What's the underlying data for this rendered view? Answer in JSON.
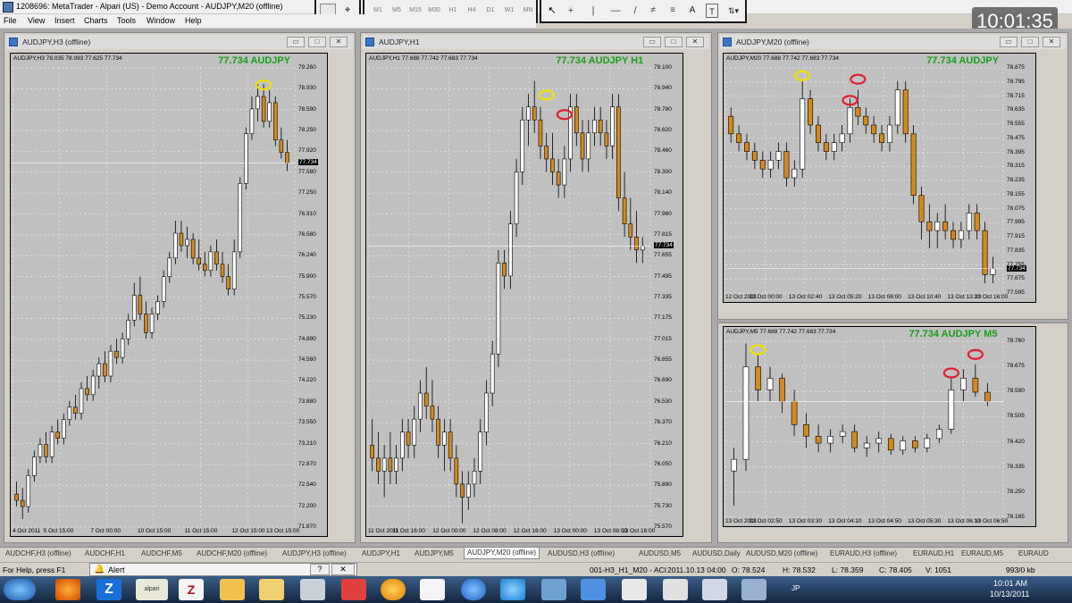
{
  "window_title": "1208696: MetaTrader - Alpari (US) - Demo Account - AUDJPY,M20 (offline)",
  "menu": [
    "File",
    "View",
    "Insert",
    "Charts",
    "Tools",
    "Window",
    "Help"
  ],
  "timeframes": [
    "M1",
    "M5",
    "M15",
    "M30",
    "H1",
    "H4",
    "D1",
    "W1",
    "MN"
  ],
  "clock": "10:01:35",
  "charts": [
    {
      "title": "AUDJPY,H3 (offline)",
      "info": "AUDJPY,H3  78.035 78.093 77.625 77.734",
      "big_label": "77.734 AUDJPY",
      "current": "77.734",
      "price_labels": [
        "79.260",
        "78.930",
        "78.590",
        "78.250",
        "77.920",
        "77.580",
        "77.250",
        "76.910",
        "76.580",
        "76.240",
        "75.900",
        "75.570",
        "75.230",
        "74.890",
        "74.560",
        "74.220",
        "73.880",
        "73.550",
        "73.210",
        "72.870",
        "72.540",
        "72.200",
        "71.870"
      ],
      "time_labels": [
        "4 Oct 2011",
        "5 Oct 15:00",
        "7 Oct 00:00",
        "10 Oct 15:00",
        "11 Oct 15:00",
        "12 Oct 15:00",
        "13 Oct 15:00"
      ],
      "ymin": 71.87,
      "ymax": 79.26,
      "candles": [
        [
          72.4,
          72.6,
          72.2,
          72.3
        ],
        [
          72.3,
          72.5,
          72.0,
          72.2
        ],
        [
          72.2,
          72.8,
          72.1,
          72.7
        ],
        [
          72.7,
          73.1,
          72.6,
          73.0
        ],
        [
          73.0,
          73.3,
          72.9,
          73.2
        ],
        [
          73.2,
          73.4,
          72.9,
          73.0
        ],
        [
          73.0,
          73.5,
          72.9,
          73.4
        ],
        [
          73.4,
          73.6,
          73.2,
          73.3
        ],
        [
          73.3,
          73.7,
          73.2,
          73.6
        ],
        [
          73.6,
          73.9,
          73.5,
          73.8
        ],
        [
          73.8,
          74.0,
          73.6,
          73.7
        ],
        [
          73.7,
          74.2,
          73.6,
          74.1
        ],
        [
          74.1,
          74.3,
          73.9,
          74.0
        ],
        [
          74.0,
          74.4,
          73.9,
          74.3
        ],
        [
          74.3,
          74.6,
          74.1,
          74.5
        ],
        [
          74.5,
          74.7,
          74.2,
          74.3
        ],
        [
          74.3,
          74.8,
          74.2,
          74.7
        ],
        [
          74.7,
          74.9,
          74.5,
          74.6
        ],
        [
          74.6,
          75.0,
          74.5,
          74.9
        ],
        [
          74.9,
          75.3,
          74.8,
          75.2
        ],
        [
          75.2,
          75.8,
          75.1,
          75.6
        ],
        [
          75.6,
          75.9,
          75.2,
          75.3
        ],
        [
          75.3,
          75.5,
          74.9,
          75.0
        ],
        [
          75.0,
          75.4,
          74.9,
          75.3
        ],
        [
          75.3,
          75.6,
          75.2,
          75.5
        ],
        [
          75.5,
          76.0,
          75.4,
          75.9
        ],
        [
          75.9,
          76.3,
          75.8,
          76.2
        ],
        [
          76.2,
          76.8,
          76.1,
          76.6
        ],
        [
          76.6,
          76.8,
          76.3,
          76.4
        ],
        [
          76.4,
          76.7,
          76.2,
          76.5
        ],
        [
          76.5,
          76.6,
          76.1,
          76.2
        ],
        [
          76.2,
          76.5,
          76.0,
          76.1
        ],
        [
          76.1,
          76.3,
          75.9,
          76.0
        ],
        [
          76.0,
          76.4,
          75.9,
          76.3
        ],
        [
          76.3,
          76.5,
          76.0,
          76.1
        ],
        [
          76.1,
          76.3,
          75.8,
          75.9
        ],
        [
          75.9,
          76.1,
          75.6,
          75.7
        ],
        [
          75.7,
          76.5,
          75.6,
          76.3
        ],
        [
          76.3,
          77.5,
          76.2,
          77.4
        ],
        [
          77.4,
          78.3,
          77.3,
          78.2
        ],
        [
          78.2,
          78.8,
          78.1,
          78.6
        ],
        [
          78.6,
          79.0,
          78.4,
          78.8
        ],
        [
          78.8,
          79.0,
          78.3,
          78.4
        ],
        [
          78.4,
          78.9,
          78.3,
          78.7
        ],
        [
          78.7,
          78.8,
          78.0,
          78.1
        ],
        [
          78.1,
          78.3,
          77.8,
          77.9
        ],
        [
          77.9,
          78.1,
          77.6,
          77.73
        ]
      ],
      "markers": [
        {
          "color": "yellow",
          "i": 42,
          "p": 78.9
        }
      ]
    },
    {
      "title": "AUDJPY,H1",
      "info": "AUDJPY,H1  77.688 77.742 77.683 77.734",
      "big_label": "77.734 AUDJPY H1",
      "current": "77.734",
      "price_labels": [
        "79.100",
        "78.940",
        "78.780",
        "78.620",
        "78.460",
        "78.300",
        "78.140",
        "77.980",
        "77.815",
        "77.655",
        "77.495",
        "77.335",
        "77.175",
        "77.015",
        "76.855",
        "76.690",
        "76.530",
        "76.370",
        "76.210",
        "76.050",
        "75.890",
        "75.730",
        "75.570"
      ],
      "time_labels": [
        "11 Oct 2011",
        "11 Oct 16:00",
        "12 Oct 00:00",
        "12 Oct 08:00",
        "12 Oct 16:00",
        "13 Oct 00:00",
        "13 Oct 08:00",
        "13 Oct 16:00"
      ],
      "ymin": 75.57,
      "ymax": 79.1,
      "candles": [
        [
          76.2,
          76.4,
          76.0,
          76.1
        ],
        [
          76.1,
          76.3,
          75.9,
          76.0
        ],
        [
          76.0,
          76.2,
          75.8,
          76.1
        ],
        [
          76.1,
          76.3,
          75.9,
          76.0
        ],
        [
          76.0,
          76.2,
          75.9,
          76.1
        ],
        [
          76.1,
          76.4,
          76.0,
          76.3
        ],
        [
          76.3,
          76.4,
          76.1,
          76.2
        ],
        [
          76.2,
          76.5,
          76.1,
          76.4
        ],
        [
          76.4,
          76.7,
          76.3,
          76.6
        ],
        [
          76.6,
          76.8,
          76.4,
          76.5
        ],
        [
          76.5,
          76.7,
          76.3,
          76.4
        ],
        [
          76.4,
          76.5,
          76.1,
          76.2
        ],
        [
          76.2,
          76.4,
          76.0,
          76.3
        ],
        [
          76.3,
          76.4,
          76.0,
          76.1
        ],
        [
          76.1,
          76.2,
          75.8,
          75.9
        ],
        [
          75.9,
          76.0,
          75.6,
          75.8
        ],
        [
          75.8,
          76.0,
          75.7,
          75.9
        ],
        [
          75.9,
          76.1,
          75.8,
          76.0
        ],
        [
          76.0,
          76.4,
          75.9,
          76.3
        ],
        [
          76.3,
          76.7,
          76.2,
          76.6
        ],
        [
          76.6,
          77.0,
          76.5,
          76.9
        ],
        [
          76.9,
          77.7,
          76.8,
          77.6
        ],
        [
          77.6,
          77.7,
          77.4,
          77.5
        ],
        [
          77.5,
          78.0,
          77.4,
          77.9
        ],
        [
          77.9,
          78.4,
          77.8,
          78.3
        ],
        [
          78.3,
          78.8,
          78.2,
          78.7
        ],
        [
          78.7,
          78.9,
          78.5,
          78.8
        ],
        [
          78.8,
          79.0,
          78.6,
          78.7
        ],
        [
          78.7,
          78.8,
          78.4,
          78.5
        ],
        [
          78.5,
          78.6,
          78.3,
          78.4
        ],
        [
          78.4,
          78.6,
          78.2,
          78.3
        ],
        [
          78.3,
          78.4,
          78.1,
          78.2
        ],
        [
          78.2,
          78.5,
          78.1,
          78.4
        ],
        [
          78.4,
          78.9,
          78.3,
          78.8
        ],
        [
          78.8,
          78.9,
          78.5,
          78.6
        ],
        [
          78.6,
          78.7,
          78.3,
          78.4
        ],
        [
          78.4,
          78.7,
          78.3,
          78.6
        ],
        [
          78.6,
          78.8,
          78.5,
          78.7
        ],
        [
          78.7,
          78.8,
          78.5,
          78.6
        ],
        [
          78.6,
          78.7,
          78.4,
          78.5
        ],
        [
          78.5,
          78.9,
          78.4,
          78.8
        ],
        [
          78.8,
          78.9,
          78.0,
          78.1
        ],
        [
          78.1,
          78.3,
          77.8,
          77.9
        ],
        [
          77.9,
          78.1,
          77.7,
          77.8
        ],
        [
          77.8,
          78.0,
          77.6,
          77.7
        ],
        [
          77.7,
          77.8,
          77.6,
          77.73
        ]
      ],
      "markers": [
        {
          "color": "yellow",
          "i": 29,
          "p": 78.85
        },
        {
          "color": "red",
          "i": 32,
          "p": 78.7
        }
      ]
    },
    {
      "title": "AUDJPY,M20 (offline)",
      "info": "AUDJPY,M20  77.688 77.742 77.683 77.734",
      "big_label": "77.734 AUDJPY",
      "current": "77.734",
      "price_labels": [
        "78.875",
        "78.795",
        "78.715",
        "78.635",
        "78.555",
        "78.475",
        "78.395",
        "78.315",
        "78.235",
        "78.155",
        "78.075",
        "77.995",
        "77.915",
        "77.835",
        "77.755",
        "77.675",
        "77.595"
      ],
      "time_labels": [
        "12 Oct 2011",
        "13 Oct 00:00",
        "13 Oct 02:40",
        "13 Oct 05:20",
        "13 Oct 08:00",
        "13 Oct 10:40",
        "13 Oct 13:20",
        "13 Oct 16:00"
      ],
      "ymin": 77.595,
      "ymax": 78.875,
      "candles": [
        [
          78.6,
          78.65,
          78.45,
          78.5
        ],
        [
          78.5,
          78.55,
          78.4,
          78.45
        ],
        [
          78.45,
          78.5,
          78.35,
          78.4
        ],
        [
          78.4,
          78.45,
          78.3,
          78.35
        ],
        [
          78.35,
          78.4,
          78.25,
          78.3
        ],
        [
          78.3,
          78.4,
          78.25,
          78.35
        ],
        [
          78.35,
          78.45,
          78.3,
          78.4
        ],
        [
          78.4,
          78.45,
          78.2,
          78.25
        ],
        [
          78.25,
          78.35,
          78.2,
          78.3
        ],
        [
          78.3,
          78.8,
          78.25,
          78.7
        ],
        [
          78.7,
          78.75,
          78.5,
          78.55
        ],
        [
          78.55,
          78.6,
          78.4,
          78.45
        ],
        [
          78.45,
          78.5,
          78.35,
          78.4
        ],
        [
          78.4,
          78.5,
          78.35,
          78.45
        ],
        [
          78.45,
          78.55,
          78.4,
          78.5
        ],
        [
          78.5,
          78.7,
          78.45,
          78.65
        ],
        [
          78.65,
          78.75,
          78.55,
          78.6
        ],
        [
          78.6,
          78.65,
          78.5,
          78.55
        ],
        [
          78.55,
          78.6,
          78.45,
          78.5
        ],
        [
          78.5,
          78.55,
          78.4,
          78.45
        ],
        [
          78.45,
          78.6,
          78.4,
          78.55
        ],
        [
          78.55,
          78.8,
          78.5,
          78.75
        ],
        [
          78.75,
          78.8,
          78.45,
          78.5
        ],
        [
          78.5,
          78.55,
          78.1,
          78.15
        ],
        [
          78.15,
          78.2,
          77.9,
          78.0
        ],
        [
          78.0,
          78.1,
          77.85,
          77.95
        ],
        [
          77.95,
          78.05,
          77.85,
          78.0
        ],
        [
          78.0,
          78.1,
          77.9,
          77.95
        ],
        [
          77.95,
          78.0,
          77.85,
          77.9
        ],
        [
          77.9,
          78.0,
          77.85,
          77.95
        ],
        [
          77.95,
          78.1,
          77.9,
          78.05
        ],
        [
          78.05,
          78.1,
          77.9,
          77.95
        ],
        [
          77.95,
          78.0,
          77.65,
          77.7
        ],
        [
          77.7,
          77.8,
          77.65,
          77.734
        ]
      ],
      "markers": [
        {
          "color": "yellow",
          "i": 9,
          "p": 78.8
        },
        {
          "color": "red",
          "i": 16,
          "p": 78.78
        },
        {
          "color": "red",
          "i": 15,
          "p": 78.66
        }
      ]
    },
    {
      "title": "",
      "info": "AUDJPY,M5  77.688 77.742 77.683 77.734",
      "big_label": "77.734 AUDJPY M5",
      "current": "",
      "price_labels": [
        "78.760",
        "78.675",
        "78.590",
        "78.505",
        "78.420",
        "78.335",
        "78.250",
        "78.165"
      ],
      "time_labels": [
        "13 Oct 2011",
        "13 Oct 02:50",
        "13 Oct 03:30",
        "13 Oct 04:10",
        "13 Oct 04:50",
        "13 Oct 05:30",
        "13 Oct 06:10",
        "13 Oct 06:50"
      ],
      "ymin": 78.1,
      "ymax": 78.86,
      "candles": [
        [
          78.3,
          78.4,
          78.15,
          78.35
        ],
        [
          78.35,
          78.85,
          78.3,
          78.75
        ],
        [
          78.75,
          78.8,
          78.6,
          78.65
        ],
        [
          78.65,
          78.75,
          78.6,
          78.7
        ],
        [
          78.7,
          78.72,
          78.55,
          78.6
        ],
        [
          78.6,
          78.65,
          78.45,
          78.5
        ],
        [
          78.5,
          78.55,
          78.4,
          78.45
        ],
        [
          78.45,
          78.5,
          78.38,
          78.42
        ],
        [
          78.42,
          78.48,
          78.38,
          78.45
        ],
        [
          78.45,
          78.5,
          78.42,
          78.47
        ],
        [
          78.47,
          78.5,
          78.38,
          78.4
        ],
        [
          78.4,
          78.45,
          78.36,
          78.42
        ],
        [
          78.42,
          78.47,
          78.38,
          78.44
        ],
        [
          78.44,
          78.46,
          78.37,
          78.39
        ],
        [
          78.39,
          78.45,
          78.37,
          78.43
        ],
        [
          78.43,
          78.45,
          78.38,
          78.4
        ],
        [
          78.4,
          78.46,
          78.38,
          78.44
        ],
        [
          78.44,
          78.5,
          78.42,
          78.48
        ],
        [
          78.48,
          78.7,
          78.46,
          78.65
        ],
        [
          78.65,
          78.74,
          78.6,
          78.7
        ],
        [
          78.7,
          78.76,
          78.62,
          78.64
        ],
        [
          78.64,
          78.68,
          78.58,
          78.6
        ]
      ],
      "markers": [
        {
          "color": "yellow",
          "i": 2,
          "p": 78.8
        },
        {
          "color": "red",
          "i": 18,
          "p": 78.7
        },
        {
          "color": "red",
          "i": 20,
          "p": 78.78
        }
      ]
    }
  ],
  "tabs": [
    "AUDCHF,H3 (offline)",
    "AUDCHF,H1",
    "AUDCHF,M5",
    "AUDCHF,M20 (offline)",
    "AUDJPY,H3 (offline)",
    "AUDJPY,H1",
    "AUDJPY,M5",
    "AUDJPY,M20 (offline)",
    "AUDUSD,H3 (offline)",
    "AUDUSD,M5",
    "AUDUSD,Daily",
    "AUDUSD,M20 (offline)",
    "EURAUD,H3 (offline)",
    "EURAUD,H1",
    "EURAUD,M5",
    "EURAUD"
  ],
  "active_tab": 7,
  "status": {
    "help": "For Help, press F1",
    "alert": "Alert",
    "profile": "001-H3_H1_M20 - ACI",
    "datetime": "2011.10.13 04:00",
    "open": "O: 78.524",
    "high": "H: 78.532",
    "low": "L: 78.359",
    "close": "C: 78.405",
    "volume": "V: 1051",
    "traffic": "993/0 kb"
  },
  "tray": {
    "time": "10:01 AM",
    "date": "10/13/2011",
    "lang": "JP"
  },
  "colors": {
    "bull": "#ffffff",
    "bear": "#d08a20",
    "plot_bg": "#c0c0c0",
    "label": "#18a018"
  }
}
